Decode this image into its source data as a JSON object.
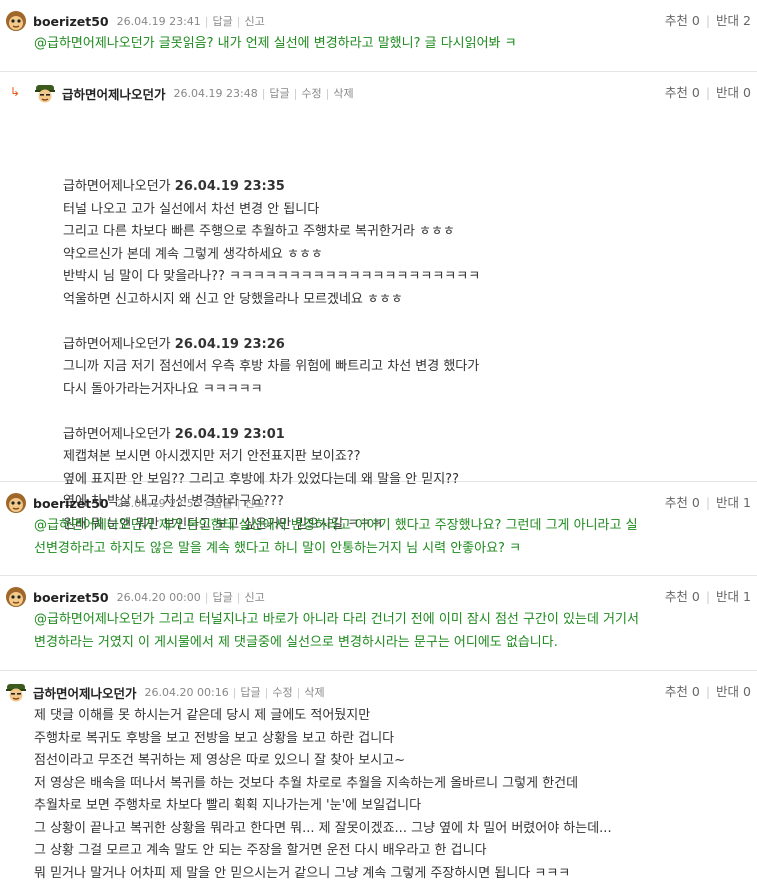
{
  "comments": [
    {
      "nick": "boerizet50",
      "date": "26.04.19 23:41",
      "actions": [
        "답글",
        "신고"
      ],
      "votes_up_label": "추천",
      "votes_up": "0",
      "votes_down_label": "반대",
      "votes_down": "2",
      "lines": [
        "@급하면어제나오던가 글못읽음? 내가 언제 실선에 변경하라고 말했니? 글 다시읽어봐 ㅋ"
      ]
    },
    {
      "nick": "급하면어제나오던가",
      "date": "26.04.19 23:48",
      "actions": [
        "답글",
        "수정",
        "삭제"
      ],
      "votes_up_label": "추천",
      "votes_up": "0",
      "votes_down_label": "반대",
      "votes_down": "0",
      "quotes": [
        {
          "name": "급하면어제나오던가",
          "time": "26.04.19 23:35",
          "lines": [
            "터널 나오고 고가 실선에서 차선 변경 안 됩니다",
            "그리고 다른 차보다 빠른 주행으로 추월하고 주행차로 복귀한거라 ㅎㅎㅎ",
            "약오르신가 본데 계속 그렇게 생각하세요 ㅎㅎㅎ",
            "반박시 님 말이 다 맞을라나?? ㅋㅋㅋㅋㅋㅋㅋㅋㅋㅋㅋㅋㅋㅋㅋㅋㅋㅋㅋㅋㅋ",
            "억울하면 신고하시지 왜 신고 안 당했을라나 모르겠네요 ㅎㅎㅎ"
          ]
        },
        {
          "name": "급하면어제나오던가",
          "time": "26.04.19 23:26",
          "lines": [
            "그니까 지금 저기 점선에서 우측 후방 차를 위험에 빠트리고 차선 변경 했다가",
            "다시 돌아가라는거자나요 ㅋㅋㅋㅋㅋ"
          ]
        },
        {
          "name": "급하면어제나오던가",
          "time": "26.04.19 23:01",
          "lines": [
            "제캡쳐본 보시면 아시겠지만 저기 안전표지판 보이죠??",
            "옆에 표지판 안 보임?? 그리고 후방에 차가 있었다는데 왜 말을 안 믿지??",
            "옆에 차 박살 내고 차선 변경하라구요???",
            "원래 뭐 눈엔 뭐만 보인다고 보고 싶은거만 믿으시길 ㅋㅋㅋ"
          ]
        }
      ]
    },
    {
      "nick": "boerizet50",
      "date": "26.04.19 23:55",
      "actions": [
        "답글",
        "신고"
      ],
      "votes_up_label": "추천",
      "votes_up": "0",
      "votes_down_label": "반대",
      "votes_down": "1",
      "lines": [
        "@급하면어제나오던가 제가 본인한테 실선에서 변경하라고 이야기 했다고 주장했나요? 그런데 그게 아니라고 실",
        "선변경하라고 하지도 않은 말을 계속 했다고 하니 말이 안통하는거지 님 시력 안좋아요? ㅋ"
      ]
    },
    {
      "nick": "boerizet50",
      "date": "26.04.20 00:00",
      "actions": [
        "답글",
        "신고"
      ],
      "votes_up_label": "추천",
      "votes_up": "0",
      "votes_down_label": "반대",
      "votes_down": "1",
      "lines": [
        "@급하면어제나오던가 그리고 터널지나고 바로가 아니라 다리 건너기 전에 이미 잠시 점선 구간이 있는데 거기서",
        "변경하라는 거였지 이 게시물에서 제 댓글중에 실선으로 변경하시라는 문구는 어디에도 없습니다."
      ]
    },
    {
      "nick": "급하면어제나오던가",
      "date": "26.04.20 00:16",
      "actions": [
        "답글",
        "수정",
        "삭제"
      ],
      "votes_up_label": "추천",
      "votes_up": "0",
      "votes_down_label": "반대",
      "votes_down": "0",
      "lines": [
        "제 댓글 이해를 못 하시는거 같은데 당시 제 글에도 적어뒀지만",
        "주행차로 복귀도 후방을 보고 전방을 보고 상황을 보고 하란 겁니다",
        "점선이라고 무조건 복귀하는 제 영상은 따로 있으니 잘 찾아 보시고~",
        "저 영상은 배속을 떠나서 복귀를 하는 것보다 추월 차로로 추월을 지속하는게 올바르니 그렇게 한건데",
        "추월차로 보면 주행차로 차보다 빨리 휙휙 지나가는게 '눈'에 보일겁니다",
        "그 상황이 끝나고 복귀한 상황을 뭐라고 한다면 뭐... 제 잘못이겠죠... 그냥 옆에 차 밀어 버렸어야 하는데...",
        "그 상황 그걸 모르고 계속 말도 안 되는 주장을 할거면 운전 다시 배우라고 한 겁니다",
        "뭐 믿거나 말거나 어차피 제 말을 안 믿으시는거 같으니 그냥 계속 그렇게 주장하시면 됩니다 ㅋㅋㅋ"
      ]
    }
  ],
  "reply_arrow": "↳",
  "colors": {
    "mention_text": "#1e8a1e",
    "reply_arrow": "#e05a1a",
    "body_text": "#333333"
  },
  "icons": {
    "avatar_boerizet50": "monkey-face-avatar-icon",
    "avatar_writer": "soldier-helmet-avatar-icon"
  }
}
